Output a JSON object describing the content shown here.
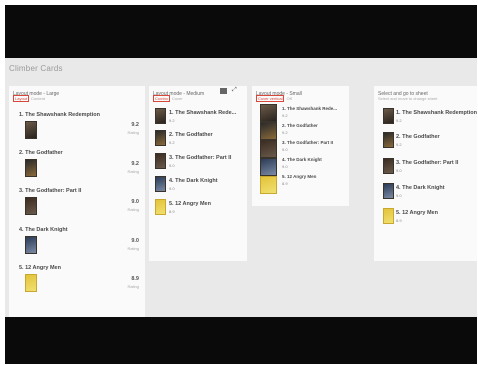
{
  "app_title": "Climber Cards",
  "panels": {
    "large": {
      "title": "Layout mode - Large",
      "sub_hl": "Layout",
      "sub": "Content"
    },
    "medium": {
      "title": "Layout mode - Medium",
      "sub_hl": "Combo",
      "sub": "Cover"
    },
    "small": {
      "title": "Layout mode - Small",
      "sub_hl": "Cover vertical",
      "sub": "Off"
    },
    "sheet": {
      "title": "Select and go to sheet",
      "sub": "Select and move to change sheet"
    }
  },
  "rating_label": "Rating",
  "movies": [
    {
      "rank_title": "1. The Shawshank Redemption",
      "short_title": "1. The Shawshank Rede...",
      "rating": "9.2"
    },
    {
      "rank_title": "2. The Godfather",
      "short_title": "2. The Godfather",
      "rating": "9.2"
    },
    {
      "rank_title": "3. The Godfather: Part II",
      "short_title": "3. The Godfather: Part II",
      "rating": "9.0"
    },
    {
      "rank_title": "4. The Dark Knight",
      "short_title": "4. The Dark Knight",
      "rating": "9.0"
    },
    {
      "rank_title": "5. 12 Angry Men",
      "short_title": "5. 12 Angry Men",
      "rating": "8.9"
    }
  ],
  "icons": {
    "medium_menu": "chart-icon",
    "medium_expand": "expand-icon"
  }
}
